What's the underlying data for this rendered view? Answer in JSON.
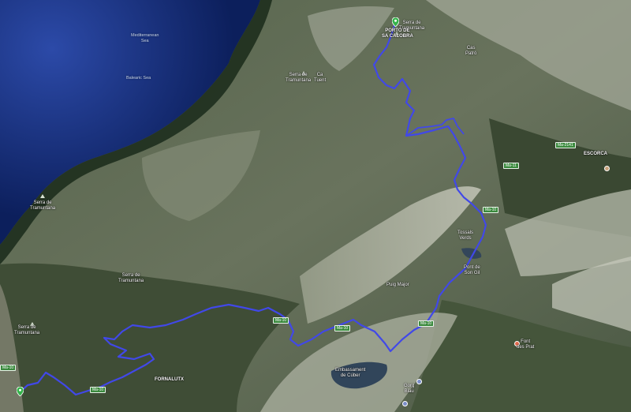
{
  "map": {
    "labels": {
      "sea1": "Mediterranean\nSea",
      "sea2": "Balearic Sea",
      "serra_top": "Serra de\nTramuntana",
      "serra_mid": "Serra de\nTramuntana",
      "serra_left": "Serra de\nTramuntana",
      "serra_bottom": "Serra de\nTramuntana",
      "cala": "Ca\nTuent",
      "tramuntana_west": "Serra de\nTramuntana",
      "mirador": "PORTO DE\nSA CALOBRA",
      "cuber": "Embassament\nde Cúber",
      "tossals": "Tossals\nVerds",
      "pont_roma": "Pont de\nSon Gil",
      "puig_major": "Puig Major",
      "fornalutx": "FORNALUTX",
      "escorca": "ESCORCA",
      "lluc": "Font\ndes Prat",
      "gorg": "Gorg\nBlau",
      "soller_road": "Cas\nPatró"
    },
    "roads": {
      "ma10_a": "Ma-10",
      "ma10_b": "Ma-10",
      "ma10_c": "Ma-10",
      "ma10_d": "Ma-10",
      "ma10_e": "Ma-10",
      "ma2141": "Ma-2141",
      "ma11": "Ma-11",
      "ma10_f": "Ma-10"
    },
    "colors": {
      "route": "#4148e8",
      "sea_deep": "#0c1f5c",
      "sea_shallow": "#2c4aa8",
      "land": "#4a5842",
      "pin": "#35b34a"
    }
  }
}
